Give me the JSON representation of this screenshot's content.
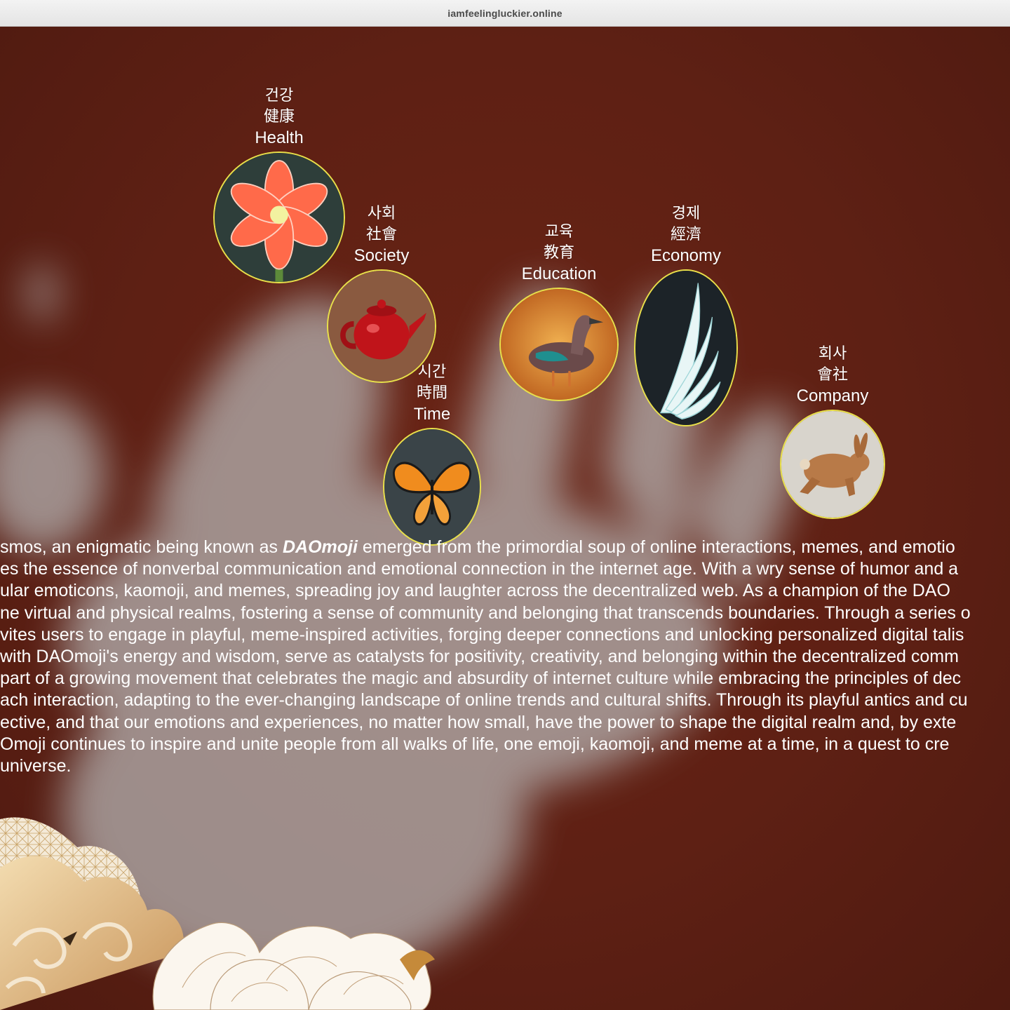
{
  "browser": {
    "url": "iamfeelingluckier.online"
  },
  "categories": [
    {
      "ko": "건강",
      "hanja": "健康",
      "en": "Health",
      "icon": "amaryllis-flower-icon"
    },
    {
      "ko": "사회",
      "hanja": "社會",
      "en": "Society",
      "icon": "red-teapot-icon"
    },
    {
      "ko": "시간",
      "hanja": "時間",
      "en": "Time",
      "icon": "monarch-butterfly-icon"
    },
    {
      "ko": "교육",
      "hanja": "教育",
      "en": "Education",
      "icon": "duck-icon"
    },
    {
      "ko": "경제",
      "hanja": "經濟",
      "en": "Economy",
      "icon": "white-wing-icon"
    },
    {
      "ko": "회사",
      "hanja": "會社",
      "en": "Company",
      "icon": "rabbit-icon"
    }
  ],
  "story": {
    "line1_before": "smos, an enigmatic being known as ",
    "brand": "DAOmoji",
    "line1_after": " emerged from the primordial soup of online interactions, memes, and emotio",
    "lines": [
      "es the essence of nonverbal communication and emotional connection in the internet age. With a wry sense of humor and a",
      "ular emoticons, kaomoji, and memes, spreading joy and laughter across the decentralized web. As a champion of the DAO",
      "ne virtual and physical realms, fostering a sense of community and belonging that transcends boundaries. Through a series o",
      "vites users to engage in playful, meme-inspired activities, forging deeper connections and unlocking personalized digital talis",
      "with DAOmoji's energy and wisdom, serve as catalysts for positivity, creativity, and belonging within the decentralized comm",
      "part of a growing movement that celebrates the magic and absurdity of internet culture while embracing the principles of dec",
      "ach interaction, adapting to the ever-changing landscape of online trends and cultural shifts. Through its playful antics and cu",
      "ective, and that our emotions and experiences, no matter how small, have the power to shape the digital realm and, by exte",
      "Omoji continues to inspire and unite people from all walks of life, one emoji, kaomoji, and meme at a time, in a quest to cre",
      "universe."
    ]
  },
  "colors": {
    "background": "#5e2014",
    "ring": "#e8e04a",
    "text": "#ffffff",
    "hand": "#b8b8b8",
    "cloud_gold": "#d9b07a"
  }
}
